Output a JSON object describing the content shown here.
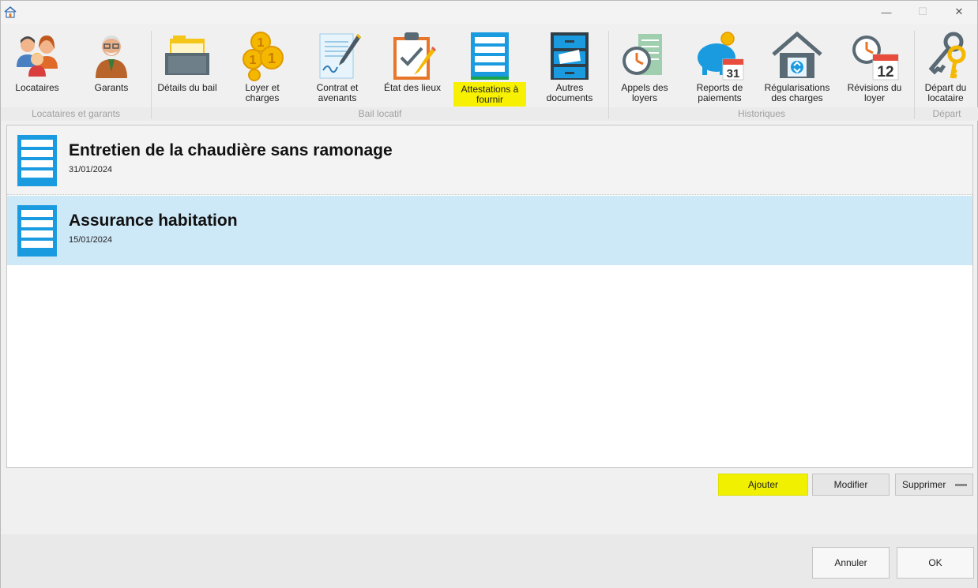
{
  "window": {
    "controls": {
      "minimize": "—",
      "maximize": "☐",
      "close": "✕"
    }
  },
  "ribbon": {
    "groups": [
      {
        "label": "Locataires et garants"
      },
      {
        "label": "Bail locatif"
      },
      {
        "label": "Historiques"
      },
      {
        "label": "Départ"
      }
    ],
    "buttons": [
      {
        "label": "Locataires",
        "icon": "tenants-icon"
      },
      {
        "label": "Garants",
        "icon": "guarantor-icon"
      },
      {
        "label": "Détails du bail",
        "icon": "folder-icon"
      },
      {
        "label": "Loyer et\ncharges",
        "icon": "coins-icon"
      },
      {
        "label": "Contrat et\navenants",
        "icon": "contract-icon"
      },
      {
        "label": "État des lieux",
        "icon": "clipboard-icon"
      },
      {
        "label": "Attestations à\nfournir",
        "icon": "attestation-icon"
      },
      {
        "label": "Autres\ndocuments",
        "icon": "cabinet-icon"
      },
      {
        "label": "Appels des\nloyers",
        "icon": "rent-calls-icon"
      },
      {
        "label": "Reports de\npaiements",
        "icon": "piggy-calendar-icon"
      },
      {
        "label": "Régularisations\ndes charges",
        "icon": "house-scale-icon"
      },
      {
        "label": "Révisions du\nloyer",
        "icon": "calendar-12-icon"
      },
      {
        "label": "Départ du\nlocataire",
        "icon": "keys-icon"
      }
    ]
  },
  "attestations": [
    {
      "title": "Entretien de la chaudière sans ramonage",
      "date": "31/01/2024"
    },
    {
      "title": "Assurance habitation",
      "date": "15/01/2024"
    }
  ],
  "actions": {
    "add": "Ajouter",
    "edit": "Modifier",
    "delete": "Supprimer"
  },
  "footer": {
    "cancel": "Annuler",
    "ok": "OK"
  },
  "colors": {
    "highlight": "#f7f000",
    "selected_row": "#cde8f6",
    "icon_blue": "#1a9be0"
  }
}
